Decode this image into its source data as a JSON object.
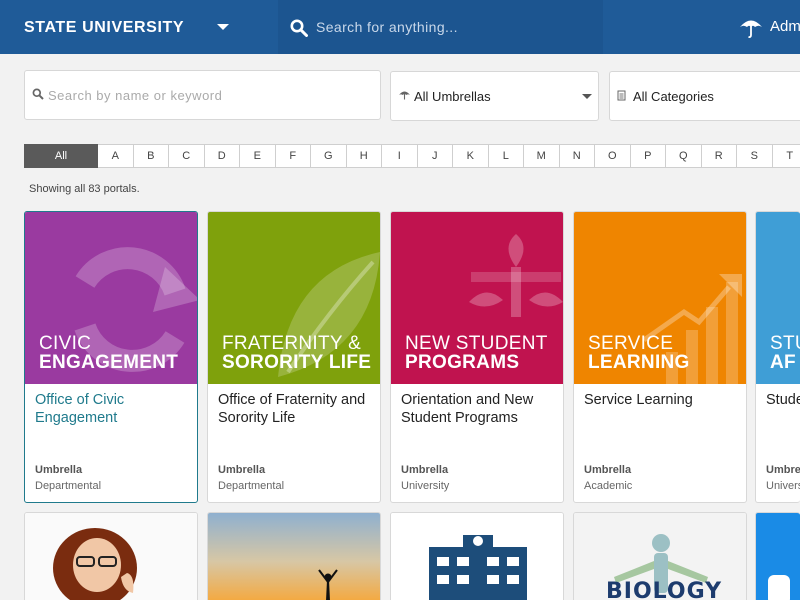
{
  "header": {
    "brand": "STATE UNIVERSITY",
    "search_placeholder": "Search for anything...",
    "user_label": "Admin"
  },
  "filters": {
    "search_placeholder": "Search by name or keyword",
    "umbrella_value": "All Umbrellas",
    "category_value": "All Categories"
  },
  "alphabet": [
    "All",
    "A",
    "B",
    "C",
    "D",
    "E",
    "F",
    "G",
    "H",
    "I",
    "J",
    "K",
    "L",
    "M",
    "N",
    "O",
    "P",
    "Q",
    "R",
    "S",
    "T"
  ],
  "status": "Showing all 83 portals.",
  "cards": [
    {
      "image_line1": "CIVIC",
      "image_line2": "ENGAGEMENT",
      "name": "Office of Civic Engagement",
      "umbrella_label": "Umbrella",
      "umbrella": "Departmental",
      "color": "#9a3aa0"
    },
    {
      "image_line1": "FRATERNITY &",
      "image_line2": "SORORITY LIFE",
      "name": "Office of Fraternity and Sorority Life",
      "umbrella_label": "Umbrella",
      "umbrella": "Departmental",
      "color": "#7fa10c"
    },
    {
      "image_line1": "NEW STUDENT",
      "image_line2": "PROGRAMS",
      "name": "Orientation and New Student Programs",
      "umbrella_label": "Umbrella",
      "umbrella": "University",
      "color": "#c0134f"
    },
    {
      "image_line1": "SERVICE",
      "image_line2": "LEARNING",
      "name": "Service Learning",
      "umbrella_label": "Umbrella",
      "umbrella": "Academic",
      "color": "#ef8500"
    },
    {
      "image_line1": "STU",
      "image_line2": "AF",
      "name": "Stude Depa",
      "umbrella_label": "Umbre",
      "umbrella": "Univers",
      "color": "#3f9ed6"
    }
  ],
  "bottom_cards": [
    {
      "image_text": ""
    },
    {
      "image_text": ""
    },
    {
      "image_text": ""
    },
    {
      "image_text": "BIOLOGY"
    },
    {
      "image_text": ""
    }
  ]
}
